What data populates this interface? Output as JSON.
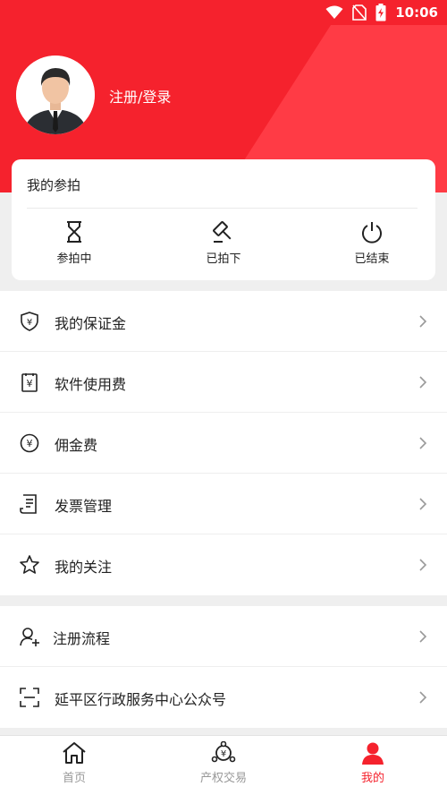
{
  "status_bar": {
    "time": "10:06",
    "icons": [
      "wifi-icon",
      "no-sim-icon",
      "battery-charging-icon"
    ]
  },
  "profile": {
    "login_text": "注册/登录",
    "avatar_icon": "user-avatar"
  },
  "auction_card": {
    "title": "我的参拍",
    "items": [
      {
        "label": "参拍中",
        "icon": "hourglass-icon"
      },
      {
        "label": "已拍下",
        "icon": "gavel-icon"
      },
      {
        "label": "已结束",
        "icon": "power-icon"
      }
    ]
  },
  "menu_group_1": [
    {
      "label": "我的保证金",
      "icon": "shield-yen-icon"
    },
    {
      "label": "软件使用费",
      "icon": "receipt-yen-icon"
    },
    {
      "label": "佣金费",
      "icon": "coin-yen-icon"
    },
    {
      "label": "发票管理",
      "icon": "invoice-icon"
    },
    {
      "label": "我的关注",
      "icon": "star-icon"
    }
  ],
  "menu_group_2": [
    {
      "label": "注册流程",
      "icon": "user-add-icon"
    },
    {
      "label": "延平区行政服务中心公众号",
      "icon": "scan-icon"
    }
  ],
  "bottom_nav": [
    {
      "label": "首页",
      "icon": "home-icon",
      "active": false
    },
    {
      "label": "产权交易",
      "icon": "exchange-icon",
      "active": false
    },
    {
      "label": "我的",
      "icon": "user-icon",
      "active": true
    }
  ],
  "colors": {
    "accent": "#f5222d",
    "accent_light": "#ff4d55",
    "text": "#222222",
    "muted": "#999999"
  }
}
